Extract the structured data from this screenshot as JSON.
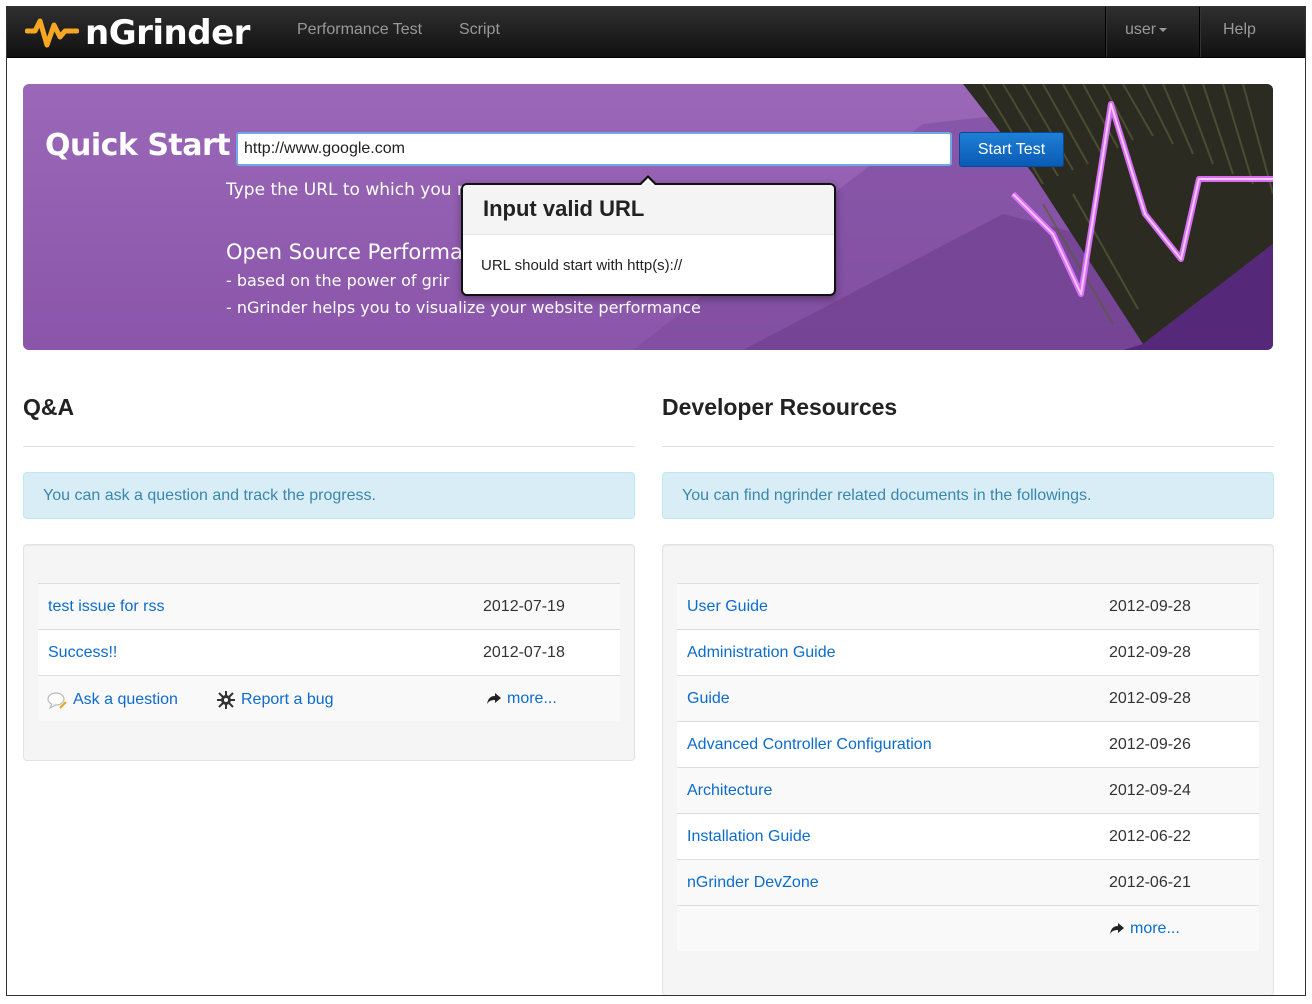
{
  "navbar": {
    "brand": "nGrinder",
    "links": [
      "Performance Test",
      "Script"
    ],
    "user_label": "user",
    "help_label": "Help"
  },
  "hero": {
    "title": "Quick Start",
    "url_value": "http://www.google.com",
    "start_button": "Start Test",
    "hint": "Type the URL to which you r",
    "heading": "Open Source Performar",
    "bullet1": "- based on the power of grir",
    "bullet2": "- nGrinder helps you to visualize your website performance"
  },
  "popover": {
    "title": "Input valid URL",
    "body": "URL should start with http(s)://"
  },
  "qa": {
    "title": "Q&A",
    "info": "You can ask a question and track the progress.",
    "rows": [
      {
        "label": "test issue for rss",
        "date": "2012-07-19"
      },
      {
        "label": "Success!!",
        "date": "2012-07-18"
      }
    ],
    "ask_label": "Ask a question",
    "bug_label": "Report a bug",
    "more_label": "more..."
  },
  "dev": {
    "title": "Developer Resources",
    "info": "You can find ngrinder related documents in the followings.",
    "rows": [
      {
        "label": "User Guide",
        "date": "2012-09-28"
      },
      {
        "label": "Administration Guide",
        "date": "2012-09-28"
      },
      {
        "label": "Guide",
        "date": "2012-09-28"
      },
      {
        "label": "Advanced Controller Configuration",
        "date": "2012-09-26"
      },
      {
        "label": "Architecture",
        "date": "2012-09-24"
      },
      {
        "label": "Installation Guide",
        "date": "2012-06-22"
      },
      {
        "label": "nGrinder DevZone",
        "date": "2012-06-21"
      }
    ],
    "more_label": "more..."
  },
  "icons": {
    "logo": "pulse-logo-icon",
    "ask": "speech-bubble-icon",
    "bug": "bug-icon",
    "more": "share-arrow-icon"
  },
  "colors": {
    "hero_purple": "#9b68b8",
    "link_blue": "#0c6ccc",
    "info_bg": "#d9edf7",
    "logo_orange": "#f5a623"
  }
}
